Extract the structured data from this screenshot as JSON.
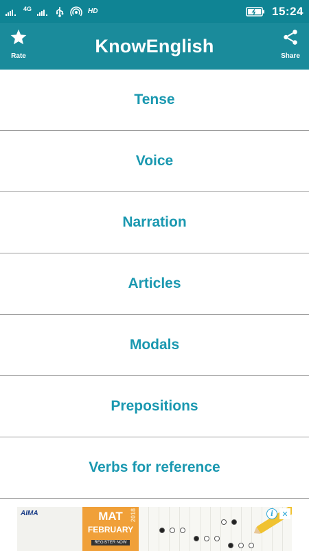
{
  "status_bar": {
    "network_label": "4G",
    "hd_label": "HD",
    "time": "15:24"
  },
  "app_bar": {
    "title": "KnowEnglish",
    "rate_label": "Rate",
    "share_label": "Share"
  },
  "topics": [
    {
      "label": "Tense"
    },
    {
      "label": "Voice"
    },
    {
      "label": "Narration"
    },
    {
      "label": "Articles"
    },
    {
      "label": "Modals"
    },
    {
      "label": "Prepositions"
    },
    {
      "label": "Verbs for reference"
    }
  ],
  "ad": {
    "logo_text": "AIMA",
    "headline": "MAT",
    "year": "2018",
    "month": "FEBRUARY",
    "cta": "REGISTER NOW"
  },
  "colors": {
    "status_bar": "#0f8494",
    "app_bar": "#1a8b9b",
    "topic_text": "#1a98b0",
    "divider": "#9c9c9c"
  }
}
